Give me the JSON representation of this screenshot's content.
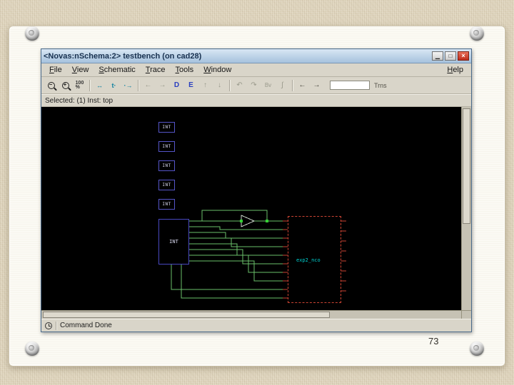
{
  "slide": {
    "page_number": "73"
  },
  "window": {
    "title": "<Novas:nSchema:2> testbench (on cad28)",
    "controls": {
      "minimize": "▁",
      "maximize": "□",
      "close": "×"
    },
    "menu": {
      "items": [
        "File",
        "View",
        "Schematic",
        "Trace",
        "Tools",
        "Window"
      ],
      "help": "Help"
    },
    "toolbar": {
      "zoom_out": "−",
      "zoom_in": "+",
      "zoom_value": "100",
      "zoom_unit": "%",
      "trace_connectivity": "↔",
      "trace_time": "t·",
      "trace_driver": "·→",
      "back": "←",
      "forward": "→",
      "driver": "D",
      "load": "E",
      "up": "↑",
      "down": "↓",
      "undo": "↶",
      "redo": "↷",
      "bus": "Bv",
      "curve": "∫",
      "prev": "←",
      "next": "→",
      "search_value": "",
      "search_label": "Trns"
    },
    "selection_status": "Selected: (1) Inst: top",
    "status_bar": "Command Done"
  },
  "canvas": {
    "inst_label": "INT",
    "module_label": "exp2_nco"
  },
  "colors": {
    "wire_green": "#6abf6a",
    "pin_red": "#cc4433",
    "inst_blue": "#5050c8",
    "label_cyan": "#00d0d0",
    "titlebar_blue": "#a6c2dd",
    "close_red": "#c03020",
    "canvas_bg": "#000000"
  }
}
